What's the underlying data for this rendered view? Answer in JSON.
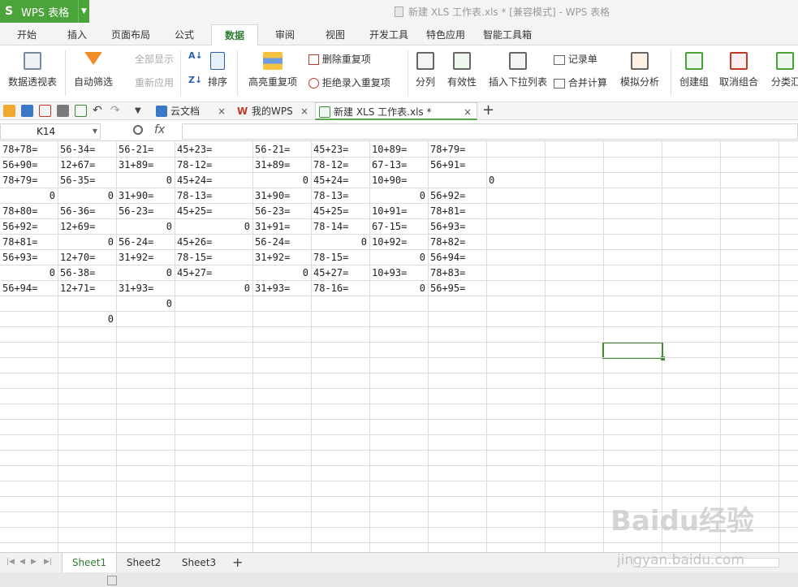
{
  "app": {
    "name": "WPS 表格",
    "document_title": "新建 XLS 工作表.xls * [兼容模式] - WPS 表格"
  },
  "menu": [
    "开始",
    "插入",
    "页面布局",
    "公式",
    "数据",
    "审阅",
    "视图",
    "开发工具",
    "特色应用",
    "智能工具箱"
  ],
  "ribbon": {
    "pivot": "数据透视表",
    "autofilter": "自动筛选",
    "show_all": "全部显示",
    "reapply": "重新应用",
    "sort": "排序",
    "highlight_dup": "高亮重复项",
    "delete_dup": "删除重复项",
    "reject_dup": "拒绝录入重复项",
    "text_to_cols": "分列",
    "validity": "有效性",
    "insert_dropdown": "插入下拉列表",
    "record_form": "记录单",
    "consolidate": "合并计算",
    "whatif": "模拟分析",
    "group": "创建组",
    "ungroup": "取消组合",
    "subtotal": "分类汇"
  },
  "tabs": [
    {
      "label": "云文档"
    },
    {
      "label": "我的WPS"
    },
    {
      "label": "新建 XLS 工作表.xls *"
    }
  ],
  "formula_bar": {
    "name_box": "K14",
    "fx": "fx",
    "formula": ""
  },
  "grid": {
    "rows": [
      [
        "78+78=",
        "56-34=",
        "56-21=",
        "45+23=",
        "56-21=",
        "45+23=",
        "10+89=",
        "78+79="
      ],
      [
        "56+90=",
        "12+67=",
        "31+89=",
        "78-12=",
        "31+89=",
        "78-12=",
        "67-13=",
        "56+91="
      ],
      [
        "78+79=",
        "56-35=",
        "0",
        "45+24=",
        "0",
        "45+24=",
        "10+90=",
        "",
        "0"
      ],
      [
        "0",
        "0",
        "31+90=",
        "78-13=",
        "31+90=",
        "78-13=",
        "0",
        "56+92="
      ],
      [
        "78+80=",
        "56-36=",
        "56-23=",
        "45+25=",
        "56-23=",
        "45+25=",
        "10+91=",
        "78+81="
      ],
      [
        "56+92=",
        "12+69=",
        "0",
        "0",
        "31+91=",
        "78-14=",
        "67-15=",
        "56+93="
      ],
      [
        "78+81=",
        "0",
        "56-24=",
        "45+26=",
        "56-24=",
        "0",
        "10+92=",
        "78+82="
      ],
      [
        "56+93=",
        "12+70=",
        "31+92=",
        "78-15=",
        "31+92=",
        "78-15=",
        "0",
        "56+94="
      ],
      [
        "0",
        "56-38=",
        "0",
        "45+27=",
        "0",
        "45+27=",
        "10+93=",
        "78+83="
      ],
      [
        "56+94=",
        "12+71=",
        "31+93=",
        "0",
        "31+93=",
        "78-16=",
        "0",
        "56+95="
      ],
      [
        "",
        "",
        "0"
      ],
      [
        "",
        "0"
      ]
    ]
  },
  "sheets": [
    "Sheet1",
    "Sheet2",
    "Sheet3"
  ],
  "watermark": {
    "line1": "Baidu经验",
    "line2": "jingyan.baidu.com"
  },
  "colors": {
    "accent": "#4aa43a",
    "selection": "#3c8f2a"
  }
}
